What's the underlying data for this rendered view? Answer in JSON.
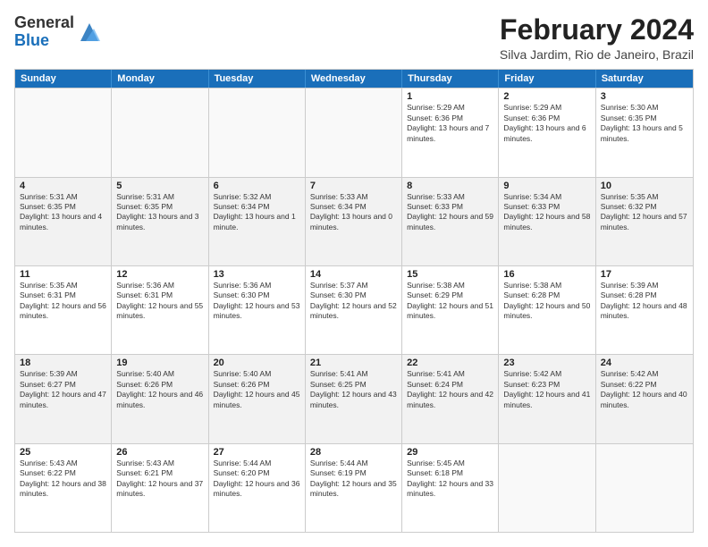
{
  "header": {
    "logo_general": "General",
    "logo_blue": "Blue",
    "title": "February 2024",
    "subtitle": "Silva Jardim, Rio de Janeiro, Brazil"
  },
  "calendar": {
    "days_of_week": [
      "Sunday",
      "Monday",
      "Tuesday",
      "Wednesday",
      "Thursday",
      "Friday",
      "Saturday"
    ],
    "rows": [
      [
        {
          "day": "",
          "info": "",
          "empty": true
        },
        {
          "day": "",
          "info": "",
          "empty": true
        },
        {
          "day": "",
          "info": "",
          "empty": true
        },
        {
          "day": "",
          "info": "",
          "empty": true
        },
        {
          "day": "1",
          "info": "Sunrise: 5:29 AM\nSunset: 6:36 PM\nDaylight: 13 hours and 7 minutes."
        },
        {
          "day": "2",
          "info": "Sunrise: 5:29 AM\nSunset: 6:36 PM\nDaylight: 13 hours and 6 minutes."
        },
        {
          "day": "3",
          "info": "Sunrise: 5:30 AM\nSunset: 6:35 PM\nDaylight: 13 hours and 5 minutes."
        }
      ],
      [
        {
          "day": "4",
          "info": "Sunrise: 5:31 AM\nSunset: 6:35 PM\nDaylight: 13 hours and 4 minutes.",
          "shaded": true
        },
        {
          "day": "5",
          "info": "Sunrise: 5:31 AM\nSunset: 6:35 PM\nDaylight: 13 hours and 3 minutes.",
          "shaded": true
        },
        {
          "day": "6",
          "info": "Sunrise: 5:32 AM\nSunset: 6:34 PM\nDaylight: 13 hours and 1 minute.",
          "shaded": true
        },
        {
          "day": "7",
          "info": "Sunrise: 5:33 AM\nSunset: 6:34 PM\nDaylight: 13 hours and 0 minutes.",
          "shaded": true
        },
        {
          "day": "8",
          "info": "Sunrise: 5:33 AM\nSunset: 6:33 PM\nDaylight: 12 hours and 59 minutes.",
          "shaded": true
        },
        {
          "day": "9",
          "info": "Sunrise: 5:34 AM\nSunset: 6:33 PM\nDaylight: 12 hours and 58 minutes.",
          "shaded": true
        },
        {
          "day": "10",
          "info": "Sunrise: 5:35 AM\nSunset: 6:32 PM\nDaylight: 12 hours and 57 minutes.",
          "shaded": true
        }
      ],
      [
        {
          "day": "11",
          "info": "Sunrise: 5:35 AM\nSunset: 6:31 PM\nDaylight: 12 hours and 56 minutes."
        },
        {
          "day": "12",
          "info": "Sunrise: 5:36 AM\nSunset: 6:31 PM\nDaylight: 12 hours and 55 minutes."
        },
        {
          "day": "13",
          "info": "Sunrise: 5:36 AM\nSunset: 6:30 PM\nDaylight: 12 hours and 53 minutes."
        },
        {
          "day": "14",
          "info": "Sunrise: 5:37 AM\nSunset: 6:30 PM\nDaylight: 12 hours and 52 minutes."
        },
        {
          "day": "15",
          "info": "Sunrise: 5:38 AM\nSunset: 6:29 PM\nDaylight: 12 hours and 51 minutes."
        },
        {
          "day": "16",
          "info": "Sunrise: 5:38 AM\nSunset: 6:28 PM\nDaylight: 12 hours and 50 minutes."
        },
        {
          "day": "17",
          "info": "Sunrise: 5:39 AM\nSunset: 6:28 PM\nDaylight: 12 hours and 48 minutes."
        }
      ],
      [
        {
          "day": "18",
          "info": "Sunrise: 5:39 AM\nSunset: 6:27 PM\nDaylight: 12 hours and 47 minutes.",
          "shaded": true
        },
        {
          "day": "19",
          "info": "Sunrise: 5:40 AM\nSunset: 6:26 PM\nDaylight: 12 hours and 46 minutes.",
          "shaded": true
        },
        {
          "day": "20",
          "info": "Sunrise: 5:40 AM\nSunset: 6:26 PM\nDaylight: 12 hours and 45 minutes.",
          "shaded": true
        },
        {
          "day": "21",
          "info": "Sunrise: 5:41 AM\nSunset: 6:25 PM\nDaylight: 12 hours and 43 minutes.",
          "shaded": true
        },
        {
          "day": "22",
          "info": "Sunrise: 5:41 AM\nSunset: 6:24 PM\nDaylight: 12 hours and 42 minutes.",
          "shaded": true
        },
        {
          "day": "23",
          "info": "Sunrise: 5:42 AM\nSunset: 6:23 PM\nDaylight: 12 hours and 41 minutes.",
          "shaded": true
        },
        {
          "day": "24",
          "info": "Sunrise: 5:42 AM\nSunset: 6:22 PM\nDaylight: 12 hours and 40 minutes.",
          "shaded": true
        }
      ],
      [
        {
          "day": "25",
          "info": "Sunrise: 5:43 AM\nSunset: 6:22 PM\nDaylight: 12 hours and 38 minutes."
        },
        {
          "day": "26",
          "info": "Sunrise: 5:43 AM\nSunset: 6:21 PM\nDaylight: 12 hours and 37 minutes."
        },
        {
          "day": "27",
          "info": "Sunrise: 5:44 AM\nSunset: 6:20 PM\nDaylight: 12 hours and 36 minutes."
        },
        {
          "day": "28",
          "info": "Sunrise: 5:44 AM\nSunset: 6:19 PM\nDaylight: 12 hours and 35 minutes."
        },
        {
          "day": "29",
          "info": "Sunrise: 5:45 AM\nSunset: 6:18 PM\nDaylight: 12 hours and 33 minutes."
        },
        {
          "day": "",
          "info": "",
          "empty": true
        },
        {
          "day": "",
          "info": "",
          "empty": true
        }
      ]
    ]
  }
}
